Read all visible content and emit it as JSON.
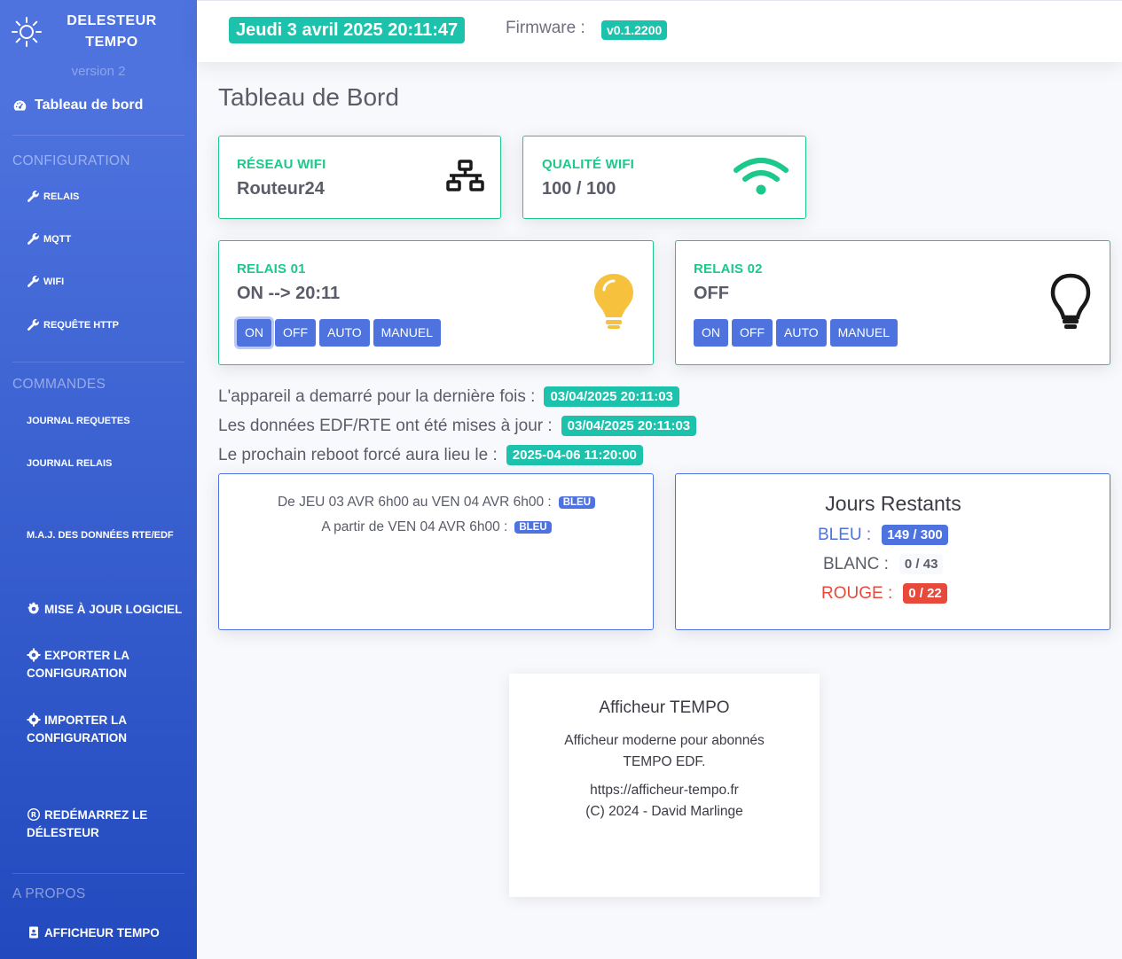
{
  "sidebar": {
    "brand_line1": "DELESTEUR",
    "brand_line2": "TEMPO",
    "version": "version 2",
    "dashboard_label": "Tableau de bord",
    "config_heading": "CONFIGURATION",
    "config_items": [
      "RELAIS",
      "MQTT",
      "WIFI",
      "REQUÊTE HTTP"
    ],
    "commands_heading": "COMMANDES",
    "journal_requetes": "JOURNAL REQUETES",
    "journal_relais": "JOURNAL RELAIS",
    "maj_donnees": "M.A.J. DES DONNÉES RTE/EDF",
    "maj_logiciel": "MISE À JOUR LOGICIEL",
    "exporter": "EXPORTER LA CONFIGURATION",
    "importer": "IMPORTER LA CONFIGURATION",
    "redemarrer": "REDÉMARREZ LE DÉLESTEUR",
    "about_heading": "A PROPOS",
    "afficheur": "AFFICHEUR TEMPO"
  },
  "topbar": {
    "datetime": "Jeudi 3 avril 2025 20:11:47",
    "firmware_label": "Firmware :",
    "firmware_version": "v0.1.2200"
  },
  "main": {
    "page_title": "Tableau de Bord",
    "wifi_network": {
      "label": "RÉSEAU WIFI",
      "value": "Routeur24",
      "icon": "network-icon"
    },
    "wifi_quality": {
      "label": "QUALITÉ WIFI",
      "value": "100 / 100",
      "icon": "wifi-icon"
    },
    "relay1": {
      "label": "RELAIS 01",
      "state": "ON --> 20:11",
      "icon": "lightbulb-on-icon",
      "buttons": [
        "ON",
        "OFF",
        "AUTO",
        "MANUEL"
      ]
    },
    "relay2": {
      "label": "RELAIS 02",
      "state": "OFF",
      "icon": "lightbulb-off-icon",
      "buttons": [
        "ON",
        "OFF",
        "AUTO",
        "MANUEL"
      ]
    },
    "info": {
      "boot_text": "L'appareil a demarré pour la dernière fois :",
      "boot_value": "03/04/2025 20:11:03",
      "update_text": "Les données EDF/RTE ont été mises à jour :",
      "update_value": "03/04/2025 20:11:03",
      "reboot_text": "Le prochain reboot forcé aura lieu le :",
      "reboot_value": "2025-04-06 11:20:00"
    },
    "tempo": {
      "line1": "De JEU 03 AVR 6h00 au VEN 04 AVR 6h00 :",
      "line1_color": "BLEU",
      "line2": "A partir de VEN 04 AVR 6h00 :",
      "line2_color": "BLEU"
    },
    "remaining": {
      "title": "Jours Restants",
      "bleu_label": "BLEU :",
      "bleu_value": "149 / 300",
      "blanc_label": "BLANC :",
      "blanc_value": "0 / 43",
      "rouge_label": "ROUGE :",
      "rouge_value": "0 / 22"
    }
  },
  "footer": {
    "title": "Afficheur TEMPO",
    "desc": "Afficheur moderne pour abonnés TEMPO EDF.",
    "url": "https://afficheur-tempo.fr",
    "copyright": "(C) 2024 - David Marlinge"
  },
  "colors": {
    "sidebar_start": "#4e73df",
    "sidebar_end": "#224abe",
    "teal": "#1cc2ac",
    "green": "#1cc88a",
    "primary": "#4e73df",
    "yellow": "#f6c23e",
    "red": "#e74a3b"
  }
}
